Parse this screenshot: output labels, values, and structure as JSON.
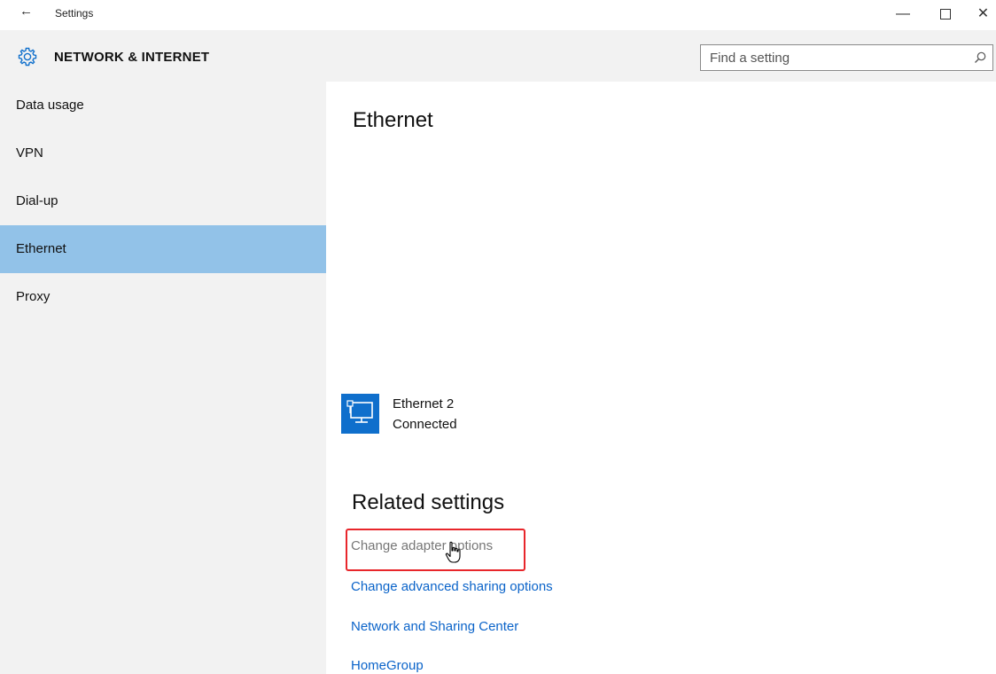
{
  "window": {
    "back_glyph": "←",
    "title": "Settings",
    "minimize_glyph": "—",
    "close_glyph": "✕"
  },
  "header": {
    "icon": "gear-icon",
    "title": "NETWORK & INTERNET",
    "search": {
      "placeholder": "Find a setting",
      "value": "",
      "icon": "search-icon"
    }
  },
  "sidebar": {
    "items": [
      {
        "label": "Data usage",
        "active": false
      },
      {
        "label": "VPN",
        "active": false
      },
      {
        "label": "Dial-up",
        "active": false
      },
      {
        "label": "Ethernet",
        "active": true
      },
      {
        "label": "Proxy",
        "active": false
      }
    ]
  },
  "main": {
    "heading": "Ethernet",
    "adapter": {
      "icon": "ethernet-adapter-icon",
      "name": "Ethernet 2",
      "status": "Connected"
    },
    "related": {
      "heading": "Related settings",
      "links": [
        {
          "label": "Change adapter options",
          "hovered": true
        },
        {
          "label": "Change advanced sharing options",
          "hovered": false
        },
        {
          "label": "Network and Sharing Center",
          "hovered": false
        },
        {
          "label": "HomeGroup",
          "hovered": false
        }
      ]
    }
  },
  "colors": {
    "accent": "#0f6fcc",
    "link": "#0a63c9",
    "selected_nav": "#92c2e8",
    "highlight_box": "#e8262b"
  }
}
